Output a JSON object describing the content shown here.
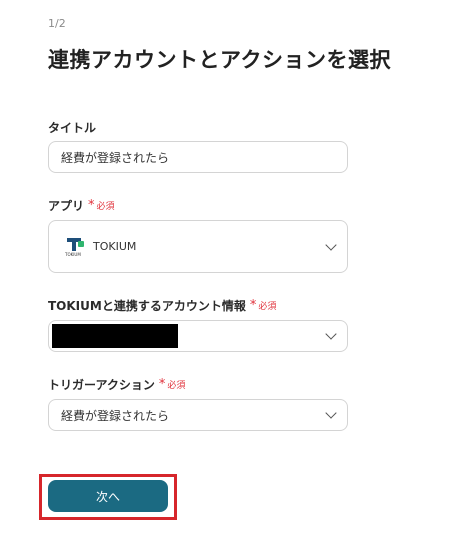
{
  "step": {
    "indicator": "1/2"
  },
  "page_title": "連携アカウントとアクションを選択",
  "title_field": {
    "label": "タイトル",
    "value": "経費が登録されたら"
  },
  "app_field": {
    "label": "アプリ",
    "required_label": "必須",
    "value": "TOKIUM",
    "logo_caption": "TOKIUM",
    "logo_icon": "tokium-logo-icon"
  },
  "account_field": {
    "label": "TOKIUMと連携するアカウント情報",
    "required_label": "必須",
    "value_redacted": true
  },
  "trigger_field": {
    "label": "トリガーアクション",
    "required_label": "必須",
    "value": "経費が登録されたら"
  },
  "next_button": {
    "label": "次へ"
  },
  "colors": {
    "accent": "#1b6a82",
    "required": "#e0303a",
    "highlight": "#d6262b"
  }
}
